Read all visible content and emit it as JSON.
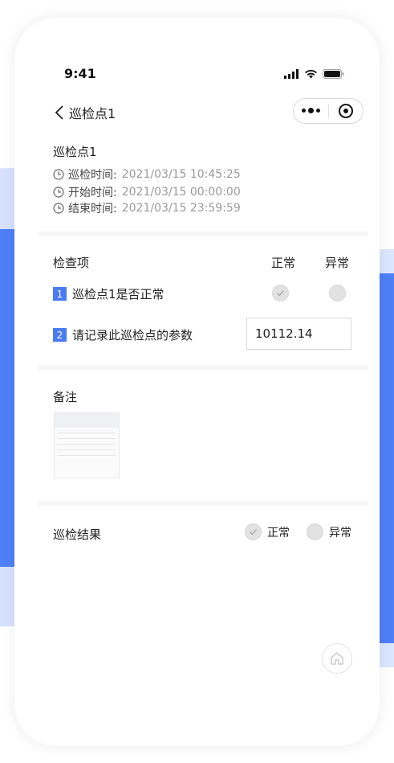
{
  "status_bar": {
    "time": "9:41"
  },
  "nav": {
    "title": "巡检点1"
  },
  "point": {
    "title": "巡检点1",
    "times": [
      {
        "label": "巡检时间:",
        "value": "2021/03/15 10:45:25"
      },
      {
        "label": "开始时间:",
        "value": "2021/03/15 00:00:00"
      },
      {
        "label": "结束时间:",
        "value": "2021/03/15 23:59:59"
      }
    ]
  },
  "checks": {
    "header": "检查项",
    "col_normal": "正常",
    "col_abnormal": "异常",
    "items": [
      {
        "num": "1",
        "label": "巡检点1是否正常"
      },
      {
        "num": "2",
        "label": "请记录此巡检点的参数",
        "value": "10112.14"
      }
    ]
  },
  "remarks": {
    "label": "备注"
  },
  "result": {
    "label": "巡检结果",
    "normal": "正常",
    "abnormal": "异常"
  },
  "colors": {
    "accent": "#4a7bf5",
    "band": "#4f80f7"
  },
  "icons": [
    "back-arrow-icon",
    "more-icon",
    "close-capsule-icon",
    "clock-icon",
    "check-icon",
    "home-icon",
    "signal-icon",
    "wifi-icon",
    "battery-icon"
  ]
}
